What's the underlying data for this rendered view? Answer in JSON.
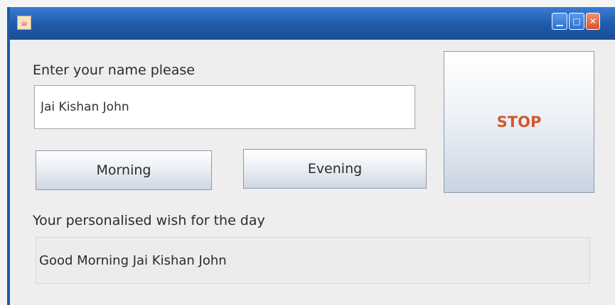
{
  "window": {
    "close_label": "✕"
  },
  "form": {
    "name_label": "Enter your name please",
    "name_value": "Jai Kishan John",
    "morning_label": "Morning",
    "evening_label": "Evening",
    "stop_label": "STOP",
    "wish_label": "Your personalised wish for the day",
    "wish_value": "Good Morning Jai Kishan John"
  },
  "colors": {
    "titlebar": "#1f5aa8",
    "stop_text": "#d4582c"
  }
}
